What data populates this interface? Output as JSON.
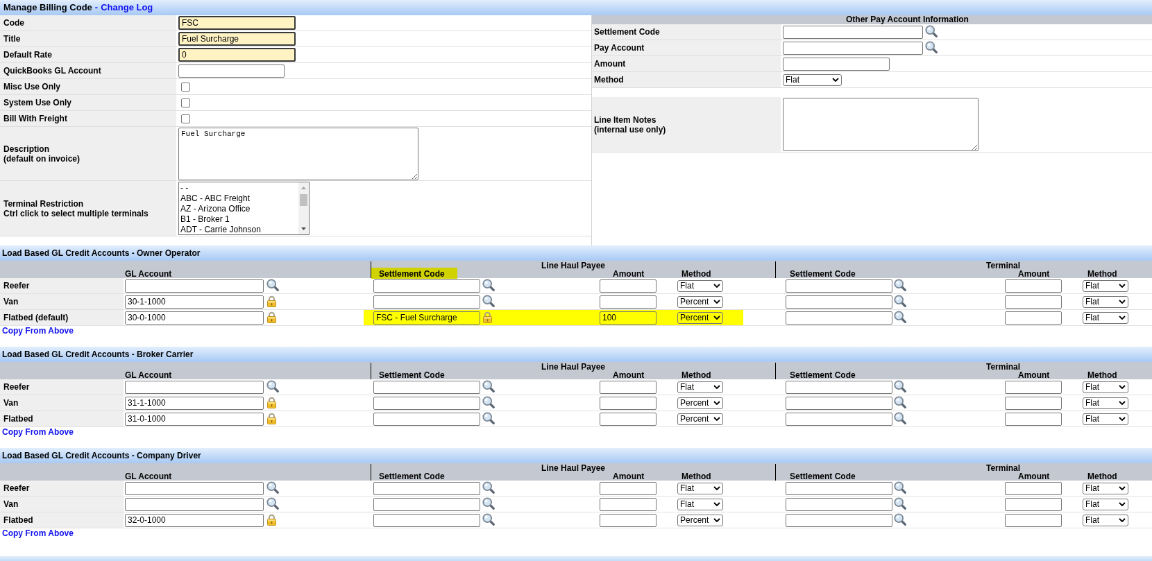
{
  "title_bar": {
    "title": "Manage Billing Code",
    "separator": "-",
    "link": "Change Log"
  },
  "billing_code_form": {
    "fields": [
      {
        "kind": "text",
        "label": "Code",
        "value": "FSC",
        "required": true
      },
      {
        "kind": "text",
        "label": "Title",
        "value": "Fuel Surcharge",
        "required": true
      },
      {
        "kind": "text",
        "label": "Default Rate",
        "value": "0",
        "required": true
      },
      {
        "kind": "text",
        "label": "QuickBooks GL Account",
        "required": false
      },
      {
        "kind": "checkbox",
        "label": "Misc Use Only",
        "checked": false
      },
      {
        "kind": "checkbox",
        "label": "System Use Only",
        "checked": false
      },
      {
        "kind": "checkbox",
        "label": "Bill With Freight",
        "checked": false
      },
      {
        "kind": "textarea",
        "label": "Description\n(default on invoice)",
        "value": "Fuel Surcharge"
      },
      {
        "kind": "listbox",
        "label": "Terminal Restriction\nCtrl click to select multiple terminals",
        "options": [
          {
            "label": "- -",
            "selected": false
          },
          {
            "label": "ABC - ABC Freight",
            "selected": false
          },
          {
            "label": "AZ - Arizona Office",
            "selected": false
          },
          {
            "label": "B1 - Broker 1",
            "selected": false
          },
          {
            "label": "ADT - Carrie Johnson",
            "selected": false
          }
        ]
      }
    ]
  },
  "other_pay_account": {
    "title": "Other Pay Account Information",
    "fields": [
      {
        "kind": "lookup",
        "label": "Settlement Code"
      },
      {
        "kind": "lookup",
        "label": "Pay Account"
      },
      {
        "kind": "text",
        "label": "Amount",
        "required": false
      },
      {
        "kind": "select",
        "label": "Method",
        "value": "Flat"
      },
      {
        "kind": "textarea",
        "label": "Line Item Notes\n(internal use only)"
      }
    ]
  },
  "sections": [
    {
      "title": "Load Based GL Credit Accounts - Owner Operator",
      "groups": [
        {
          "label": "Line Haul Payee"
        },
        {
          "label": "Terminal"
        }
      ],
      "columns": [
        {
          "label": "GL Account",
          "highlighted": false
        },
        {
          "label": "Settlement Code",
          "highlighted": true
        },
        {
          "label": "Amount",
          "highlighted": false
        },
        {
          "label": "Method",
          "highlighted": false
        },
        {
          "label": "Settlement Code",
          "highlighted": false
        },
        {
          "label": "Amount",
          "highlighted": false
        },
        {
          "label": "Method",
          "highlighted": false
        }
      ],
      "rows": [
        {
          "label": "Reefer",
          "highlighted": false,
          "gl_account": {
            "locked": false
          },
          "line_haul_payee": {
            "settlement_code": {
              "locked": false
            },
            "method": "Flat"
          },
          "terminal": {
            "settlement_code": {
              "locked": false
            },
            "method": "Flat"
          }
        },
        {
          "label": "Van",
          "highlighted": false,
          "gl_account": {
            "value": "30-1-1000",
            "locked": true
          },
          "line_haul_payee": {
            "settlement_code": {
              "locked": false
            },
            "method": "Percent"
          },
          "terminal": {
            "settlement_code": {
              "locked": false
            },
            "method": "Flat"
          }
        },
        {
          "label": "Flatbed (default)",
          "highlighted": true,
          "gl_account": {
            "value": "30-0-1000",
            "locked": true
          },
          "line_haul_payee": {
            "settlement_code": {
              "value": "FSC - Fuel Surcharge",
              "locked": true
            },
            "amount": "100",
            "method": "Percent"
          },
          "terminal": {
            "settlement_code": {
              "locked": false
            },
            "method": "Flat"
          }
        }
      ],
      "link": "Copy From Above"
    },
    {
      "title": "Load Based GL Credit Accounts - Broker Carrier",
      "groups": [
        {
          "label": "Line Haul Payee"
        },
        {
          "label": "Terminal"
        }
      ],
      "columns": [
        {
          "label": "GL Account",
          "highlighted": false
        },
        {
          "label": "Settlement Code",
          "highlighted": false
        },
        {
          "label": "Amount",
          "highlighted": false
        },
        {
          "label": "Method",
          "highlighted": false
        },
        {
          "label": "Settlement Code",
          "highlighted": false
        },
        {
          "label": "Amount",
          "highlighted": false
        },
        {
          "label": "Method",
          "highlighted": false
        }
      ],
      "rows": [
        {
          "label": "Reefer",
          "highlighted": false,
          "gl_account": {
            "locked": false
          },
          "line_haul_payee": {
            "settlement_code": {
              "locked": false
            },
            "method": "Flat"
          },
          "terminal": {
            "settlement_code": {
              "locked": false
            },
            "method": "Flat"
          }
        },
        {
          "label": "Van",
          "highlighted": false,
          "gl_account": {
            "value": "31-1-1000",
            "locked": true
          },
          "line_haul_payee": {
            "settlement_code": {
              "locked": false
            },
            "method": "Percent"
          },
          "terminal": {
            "settlement_code": {
              "locked": false
            },
            "method": "Flat"
          }
        },
        {
          "label": "Flatbed",
          "highlighted": false,
          "gl_account": {
            "value": "31-0-1000",
            "locked": true
          },
          "line_haul_payee": {
            "settlement_code": {
              "locked": false
            },
            "method": "Percent"
          },
          "terminal": {
            "settlement_code": {
              "locked": false
            },
            "method": "Flat"
          }
        }
      ],
      "link": "Copy From Above"
    },
    {
      "title": "Load Based GL Credit Accounts - Company Driver",
      "groups": [
        {
          "label": "Line Haul Payee"
        },
        {
          "label": "Terminal"
        }
      ],
      "columns": [
        {
          "label": "GL Account",
          "highlighted": false
        },
        {
          "label": "Settlement Code",
          "highlighted": false
        },
        {
          "label": "Amount",
          "highlighted": false
        },
        {
          "label": "Method",
          "highlighted": false
        },
        {
          "label": "Settlement Code",
          "highlighted": false
        },
        {
          "label": "Amount",
          "highlighted": false
        },
        {
          "label": "Method",
          "highlighted": false
        }
      ],
      "rows": [
        {
          "label": "Reefer",
          "highlighted": false,
          "gl_account": {
            "locked": false
          },
          "line_haul_payee": {
            "settlement_code": {
              "locked": false
            },
            "method": "Flat"
          },
          "terminal": {
            "settlement_code": {
              "locked": false
            },
            "method": "Flat"
          }
        },
        {
          "label": "Van",
          "highlighted": false,
          "gl_account": {
            "locked": false
          },
          "line_haul_payee": {
            "settlement_code": {
              "locked": false
            },
            "method": "Flat"
          },
          "terminal": {
            "settlement_code": {
              "locked": false
            },
            "method": "Flat"
          }
        },
        {
          "label": "Flatbed",
          "highlighted": false,
          "gl_account": {
            "value": "32-0-1000",
            "locked": true
          },
          "line_haul_payee": {
            "settlement_code": {
              "locked": false
            },
            "method": "Percent"
          },
          "terminal": {
            "settlement_code": {
              "locked": false
            },
            "method": "Flat"
          }
        }
      ],
      "link": "Copy From Above"
    }
  ]
}
